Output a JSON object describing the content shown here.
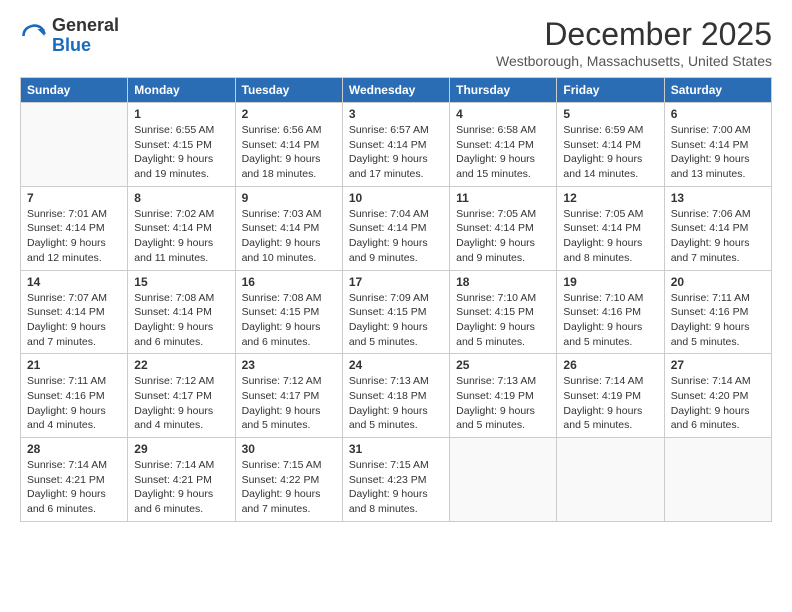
{
  "header": {
    "logo_general": "General",
    "logo_blue": "Blue",
    "month": "December 2025",
    "location": "Westborough, Massachusetts, United States"
  },
  "weekdays": [
    "Sunday",
    "Monday",
    "Tuesday",
    "Wednesday",
    "Thursday",
    "Friday",
    "Saturday"
  ],
  "weeks": [
    [
      {
        "day": "",
        "sunrise": "",
        "sunset": "",
        "daylight": ""
      },
      {
        "day": "1",
        "sunrise": "6:55 AM",
        "sunset": "4:15 PM",
        "daylight": "9 hours and 19 minutes."
      },
      {
        "day": "2",
        "sunrise": "6:56 AM",
        "sunset": "4:14 PM",
        "daylight": "9 hours and 18 minutes."
      },
      {
        "day": "3",
        "sunrise": "6:57 AM",
        "sunset": "4:14 PM",
        "daylight": "9 hours and 17 minutes."
      },
      {
        "day": "4",
        "sunrise": "6:58 AM",
        "sunset": "4:14 PM",
        "daylight": "9 hours and 15 minutes."
      },
      {
        "day": "5",
        "sunrise": "6:59 AM",
        "sunset": "4:14 PM",
        "daylight": "9 hours and 14 minutes."
      },
      {
        "day": "6",
        "sunrise": "7:00 AM",
        "sunset": "4:14 PM",
        "daylight": "9 hours and 13 minutes."
      }
    ],
    [
      {
        "day": "7",
        "sunrise": "7:01 AM",
        "sunset": "4:14 PM",
        "daylight": "9 hours and 12 minutes."
      },
      {
        "day": "8",
        "sunrise": "7:02 AM",
        "sunset": "4:14 PM",
        "daylight": "9 hours and 11 minutes."
      },
      {
        "day": "9",
        "sunrise": "7:03 AM",
        "sunset": "4:14 PM",
        "daylight": "9 hours and 10 minutes."
      },
      {
        "day": "10",
        "sunrise": "7:04 AM",
        "sunset": "4:14 PM",
        "daylight": "9 hours and 9 minutes."
      },
      {
        "day": "11",
        "sunrise": "7:05 AM",
        "sunset": "4:14 PM",
        "daylight": "9 hours and 9 minutes."
      },
      {
        "day": "12",
        "sunrise": "7:05 AM",
        "sunset": "4:14 PM",
        "daylight": "9 hours and 8 minutes."
      },
      {
        "day": "13",
        "sunrise": "7:06 AM",
        "sunset": "4:14 PM",
        "daylight": "9 hours and 7 minutes."
      }
    ],
    [
      {
        "day": "14",
        "sunrise": "7:07 AM",
        "sunset": "4:14 PM",
        "daylight": "9 hours and 7 minutes."
      },
      {
        "day": "15",
        "sunrise": "7:08 AM",
        "sunset": "4:14 PM",
        "daylight": "9 hours and 6 minutes."
      },
      {
        "day": "16",
        "sunrise": "7:08 AM",
        "sunset": "4:15 PM",
        "daylight": "9 hours and 6 minutes."
      },
      {
        "day": "17",
        "sunrise": "7:09 AM",
        "sunset": "4:15 PM",
        "daylight": "9 hours and 5 minutes."
      },
      {
        "day": "18",
        "sunrise": "7:10 AM",
        "sunset": "4:15 PM",
        "daylight": "9 hours and 5 minutes."
      },
      {
        "day": "19",
        "sunrise": "7:10 AM",
        "sunset": "4:16 PM",
        "daylight": "9 hours and 5 minutes."
      },
      {
        "day": "20",
        "sunrise": "7:11 AM",
        "sunset": "4:16 PM",
        "daylight": "9 hours and 5 minutes."
      }
    ],
    [
      {
        "day": "21",
        "sunrise": "7:11 AM",
        "sunset": "4:16 PM",
        "daylight": "9 hours and 4 minutes."
      },
      {
        "day": "22",
        "sunrise": "7:12 AM",
        "sunset": "4:17 PM",
        "daylight": "9 hours and 4 minutes."
      },
      {
        "day": "23",
        "sunrise": "7:12 AM",
        "sunset": "4:17 PM",
        "daylight": "9 hours and 5 minutes."
      },
      {
        "day": "24",
        "sunrise": "7:13 AM",
        "sunset": "4:18 PM",
        "daylight": "9 hours and 5 minutes."
      },
      {
        "day": "25",
        "sunrise": "7:13 AM",
        "sunset": "4:19 PM",
        "daylight": "9 hours and 5 minutes."
      },
      {
        "day": "26",
        "sunrise": "7:14 AM",
        "sunset": "4:19 PM",
        "daylight": "9 hours and 5 minutes."
      },
      {
        "day": "27",
        "sunrise": "7:14 AM",
        "sunset": "4:20 PM",
        "daylight": "9 hours and 6 minutes."
      }
    ],
    [
      {
        "day": "28",
        "sunrise": "7:14 AM",
        "sunset": "4:21 PM",
        "daylight": "9 hours and 6 minutes."
      },
      {
        "day": "29",
        "sunrise": "7:14 AM",
        "sunset": "4:21 PM",
        "daylight": "9 hours and 6 minutes."
      },
      {
        "day": "30",
        "sunrise": "7:15 AM",
        "sunset": "4:22 PM",
        "daylight": "9 hours and 7 minutes."
      },
      {
        "day": "31",
        "sunrise": "7:15 AM",
        "sunset": "4:23 PM",
        "daylight": "9 hours and 8 minutes."
      },
      {
        "day": "",
        "sunrise": "",
        "sunset": "",
        "daylight": ""
      },
      {
        "day": "",
        "sunrise": "",
        "sunset": "",
        "daylight": ""
      },
      {
        "day": "",
        "sunrise": "",
        "sunset": "",
        "daylight": ""
      }
    ]
  ]
}
